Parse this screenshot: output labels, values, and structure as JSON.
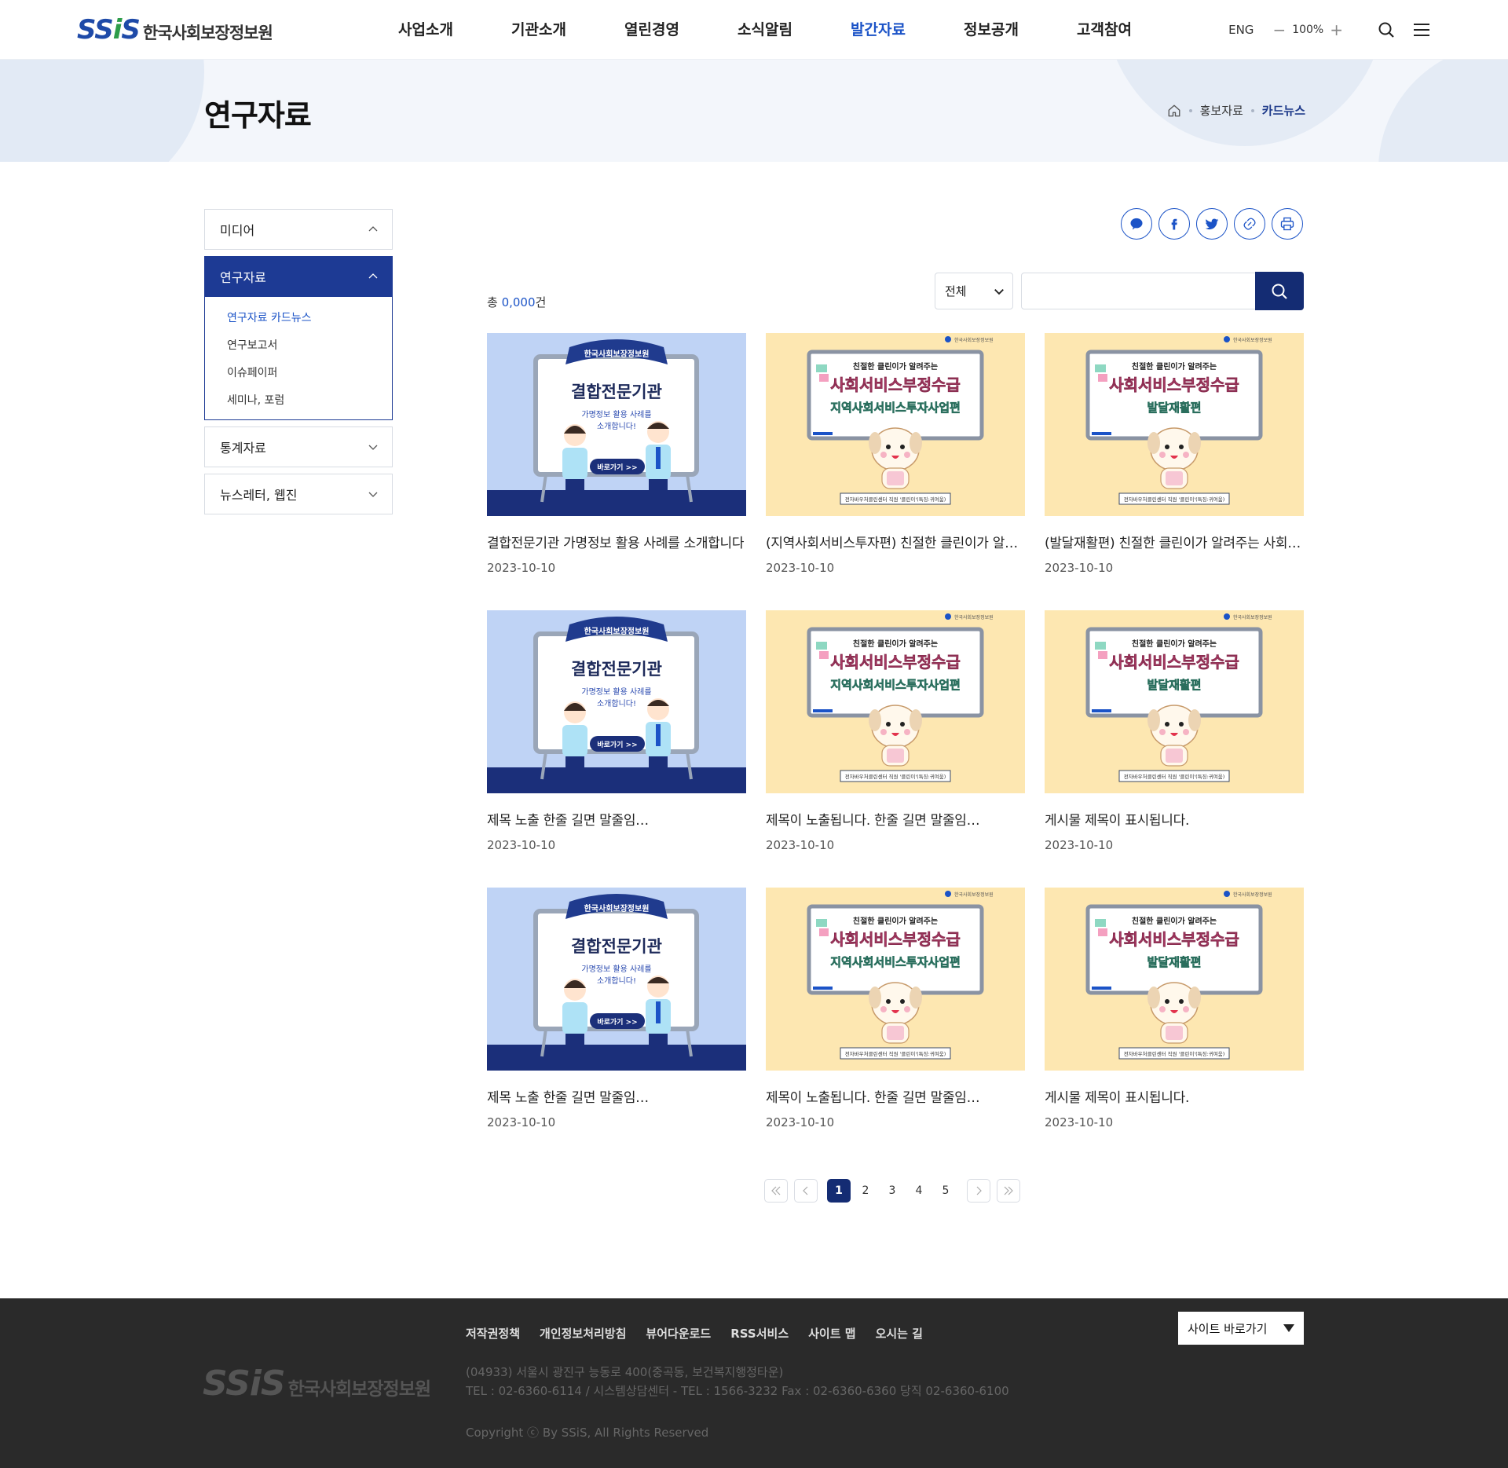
{
  "header": {
    "logo_mark": "SSiS",
    "logo_text": "한국사회보장정보원",
    "nav": [
      "사업소개",
      "기관소개",
      "열린경영",
      "소식알림",
      "발간자료",
      "정보공개",
      "고객참여"
    ],
    "nav_active": "발간자료",
    "eng": "ENG",
    "zoom_minus": "−",
    "zoom_value": "100%",
    "zoom_plus": "+"
  },
  "visual": {
    "title": "연구자료",
    "breadcrumb": [
      "홍보자료",
      "카드뉴스"
    ]
  },
  "lnb": {
    "items": [
      "미디어",
      "연구자료",
      "통계자료",
      "뉴스레터, 웹진"
    ],
    "active": "연구자료",
    "sub": [
      "연구자료 카드뉴스",
      "연구보고서",
      "이슈페이퍼",
      "세미나, 포럼"
    ],
    "sub_active": "연구자료 카드뉴스"
  },
  "search": {
    "total_prefix": "총 ",
    "total_count": "0,000",
    "total_suffix": "건",
    "select_value": "전체",
    "input_value": ""
  },
  "thumbs": {
    "a": {
      "ribbon": "한국사회보장정보원",
      "title": "결합전문기관",
      "line1": "가명정보 활용 사례를",
      "line2": "소개합니다!",
      "button": "바로가기 >>"
    },
    "b": {
      "brand": "한국사회보장정보원",
      "top": "친절한 클린이가 알려주는",
      "title": "사회서비스부정수급",
      "sub": "지역사회서비스투자사업편",
      "caption": "전자바우처클린센터 직원 '클린이'(특징:귀여움)"
    },
    "c": {
      "brand": "한국사회보장정보원",
      "top": "친절한 클린이가 알려주는",
      "title": "사회서비스부정수급",
      "sub": "발달재활편",
      "caption": "전자바우처클린센터 직원 '클린이'(특징:귀여움)"
    }
  },
  "cards": [
    {
      "type": "a",
      "title": "결합전문기관 가명정보 활용 사례를 소개합니다",
      "date": "2023-10-10"
    },
    {
      "type": "b",
      "title": "(지역사회서비스투자편) 친절한 클린이가 알려주는",
      "date": "2023-10-10"
    },
    {
      "type": "c",
      "title": "(발달재활편) 친절한 클린이가 알려주는 사회서비스",
      "date": "2023-10-10"
    },
    {
      "type": "a",
      "title": "제목 노출 한줄 길면 말줄임…",
      "date": "2023-10-10"
    },
    {
      "type": "b",
      "title": "제목이 노출됩니다. 한줄 길면 말줄임…",
      "date": "2023-10-10"
    },
    {
      "type": "c",
      "title": "게시물 제목이 표시됩니다.",
      "date": "2023-10-10"
    },
    {
      "type": "a",
      "title": "제목 노출 한줄 길면 말줄임…",
      "date": "2023-10-10"
    },
    {
      "type": "b",
      "title": "제목이 노출됩니다. 한줄 길면 말줄임…",
      "date": "2023-10-10"
    },
    {
      "type": "c",
      "title": "게시물 제목이 표시됩니다.",
      "date": "2023-10-10"
    }
  ],
  "pagination": {
    "pages": [
      "1",
      "2",
      "3",
      "4",
      "5"
    ],
    "current": "1"
  },
  "footer": {
    "links": [
      "저작권정책",
      "개인정보처리방침",
      "뷰어다운로드",
      "RSS서비스",
      "사이트 맵",
      "오시는 길"
    ],
    "site_select": "사이트 바로가기",
    "logo_mark": "SSiS",
    "logo_text": "한국사회보장정보원",
    "address": "(04933) 서울시 광진구 능동로 400(중곡동, 보건복지행정타운)",
    "tel": "TEL : 02-6360-6114 / 시스템상담센터 - TEL : 1566-3232  Fax : 02-6360-6360  당직 02-6360-6100",
    "copyright": "Copyright ⓒ By SSiS, All Rights Reserved"
  },
  "colors": {
    "primary": "#1d3a94",
    "accent": "#1b53c7",
    "dark_button": "#142c73",
    "footer_bg": "#2a2a2a"
  },
  "icons": [
    "search-icon",
    "menu-icon",
    "home-icon",
    "talk-icon",
    "facebook-icon",
    "twitter-icon",
    "link-icon",
    "print-icon",
    "chevron-up-icon",
    "chevron-down-icon"
  ]
}
